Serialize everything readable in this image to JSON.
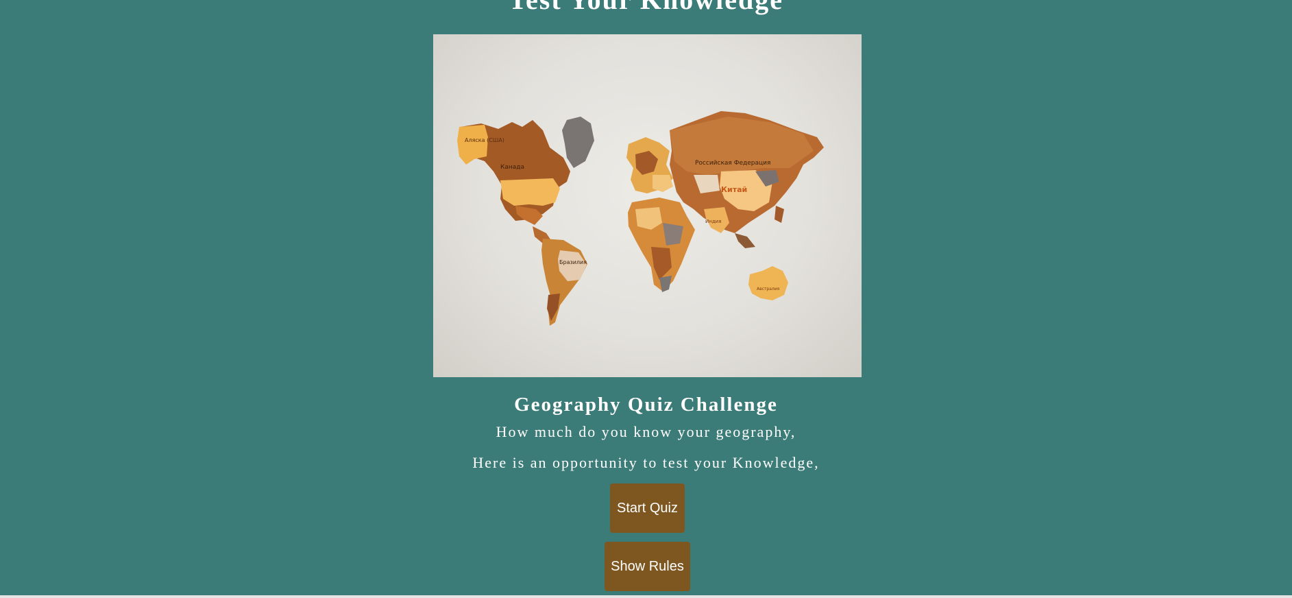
{
  "header": {
    "title": "Test Your Knowledge"
  },
  "hero": {
    "image": "world-map-puzzle-image",
    "map_labels": {
      "alaska": "Аляска (США)",
      "canada": "Канада",
      "russia": "Российская Федерация",
      "china": "Китай",
      "india": "Индия",
      "brazil": "Бразилия",
      "australia": "Австралия"
    }
  },
  "intro": {
    "title": "Geography Quiz Challenge",
    "line1": "How much do you know your geography,",
    "line2": "Here is an opportunity to test your Knowledge,"
  },
  "actions": {
    "start_label": "Start Quiz",
    "rules_label": "Show Rules"
  },
  "colors": {
    "background": "#3c7c78",
    "button": "#7e5720",
    "text": "#ffffff"
  }
}
